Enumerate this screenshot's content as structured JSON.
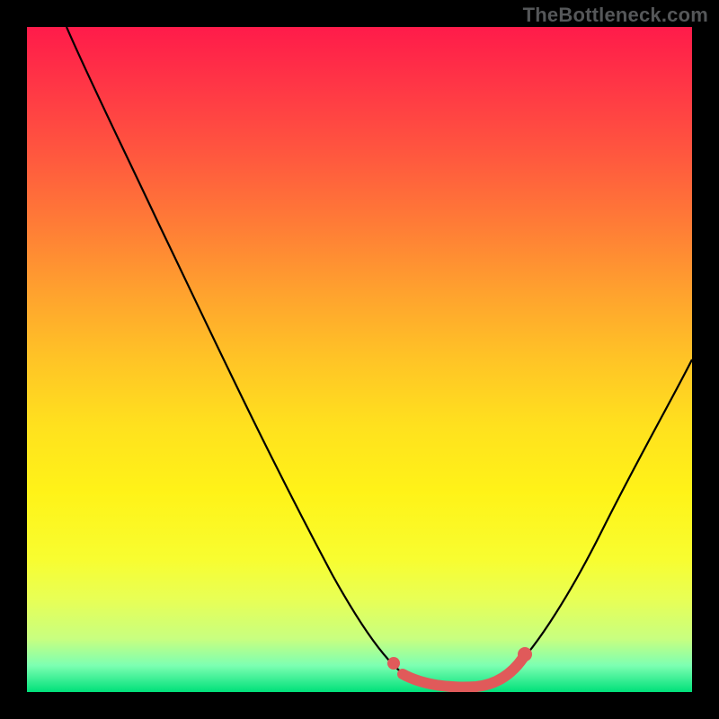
{
  "watermark": "TheBottleneck.com",
  "chart_data": {
    "type": "line",
    "title": "",
    "xlabel": "",
    "ylabel": "",
    "xlim": [
      0,
      100
    ],
    "ylim": [
      0,
      100
    ],
    "grid": false,
    "legend": false,
    "series": [
      {
        "name": "bottleneck-curve",
        "color": "#000000",
        "x": [
          6,
          10,
          15,
          20,
          25,
          30,
          35,
          40,
          45,
          50,
          53,
          55,
          58,
          60,
          63,
          65,
          68,
          70,
          73,
          75,
          80,
          85,
          90,
          95,
          100
        ],
        "y": [
          100,
          93,
          84,
          75,
          66,
          57,
          48,
          39,
          30,
          21,
          15,
          11,
          6,
          3,
          1.5,
          1,
          1,
          1.2,
          2,
          4,
          10,
          18,
          27,
          37,
          47
        ]
      },
      {
        "name": "optimal-range-highlight",
        "color": "#e05a5a",
        "x": [
          55,
          56,
          58,
          60,
          62,
          64,
          66,
          68,
          70,
          71,
          72,
          73,
          74
        ],
        "y": [
          11,
          8,
          5,
          3,
          2,
          1.5,
          1.3,
          1.3,
          1.5,
          2,
          3,
          4.5,
          6
        ]
      }
    ],
    "markers": [
      {
        "name": "marker-left",
        "x": 55,
        "y": 11,
        "color": "#e05a5a",
        "size": 8
      },
      {
        "name": "marker-right",
        "x": 74,
        "y": 6,
        "color": "#e05a5a",
        "size": 10
      }
    ],
    "background_gradient": {
      "direction": "vertical",
      "stops": [
        {
          "pos": 0.0,
          "color": "#ff1b4a"
        },
        {
          "pos": 0.5,
          "color": "#ffc426"
        },
        {
          "pos": 0.8,
          "color": "#f8fd30"
        },
        {
          "pos": 1.0,
          "color": "#00e07a"
        }
      ]
    }
  }
}
